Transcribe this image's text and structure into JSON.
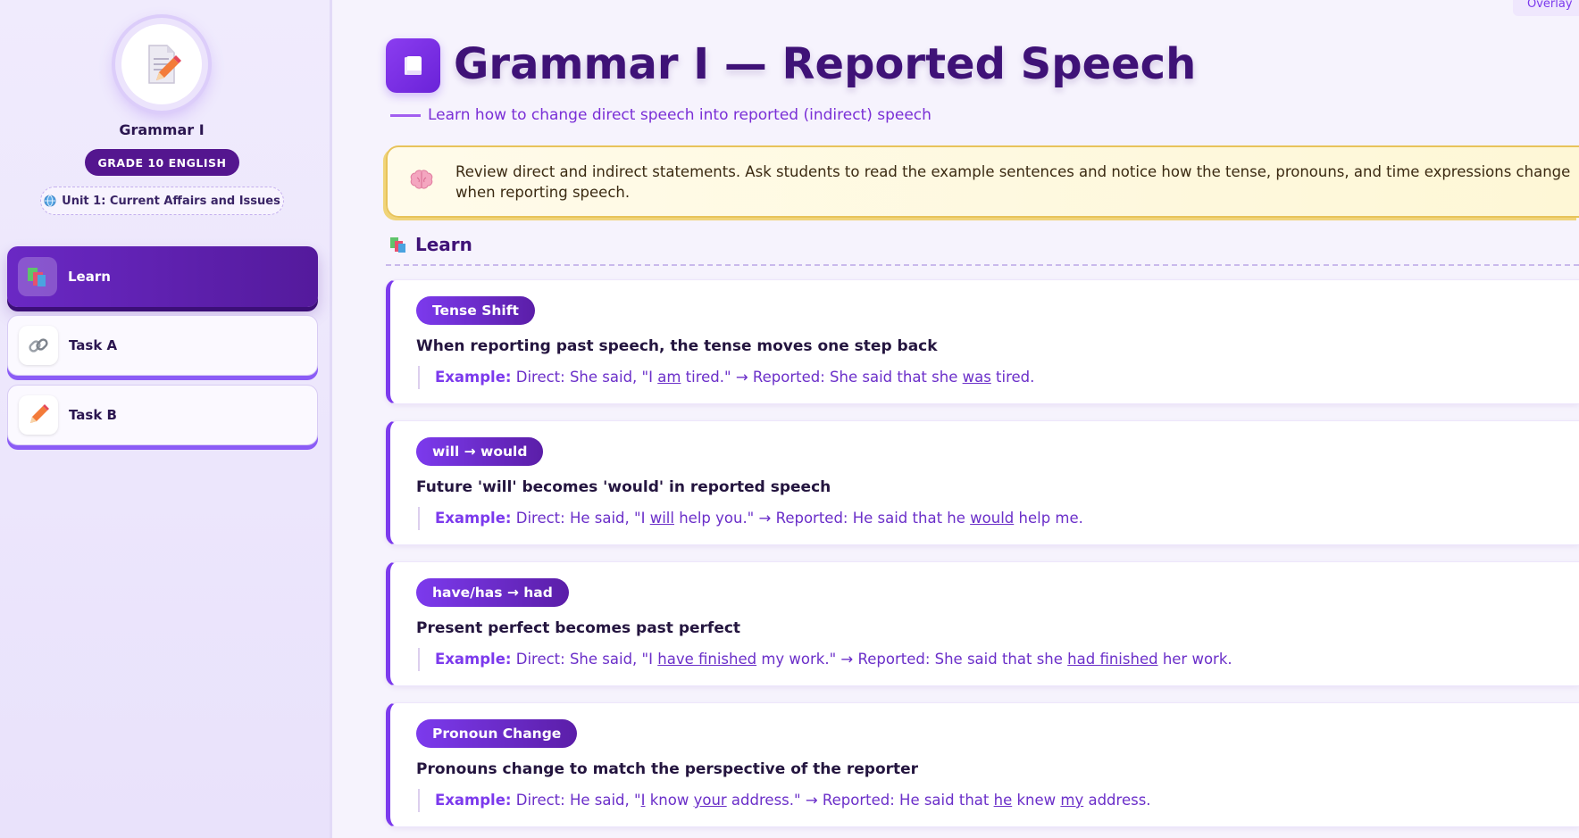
{
  "sidebar": {
    "title": "Grammar I",
    "grade_badge": "GRADE 10 ENGLISH",
    "unit": "Unit 1: Current Affairs and Issues",
    "items": [
      {
        "label": "Learn",
        "icon": "books-icon",
        "active": true
      },
      {
        "label": "Task A",
        "icon": "link-icon",
        "active": false
      },
      {
        "label": "Task B",
        "icon": "pencil-icon",
        "active": false
      }
    ]
  },
  "overlay_tab": "Overlay",
  "header": {
    "title": "Grammar I — Reported Speech",
    "subtitle": "Learn how to change direct speech into reported (indirect) speech"
  },
  "note": {
    "icon": "brain-icon",
    "text": "Review direct and indirect statements. Ask students to read the example sentences and notice how the tense, pronouns, and time expressions change when reporting speech."
  },
  "section": {
    "title": "Learn",
    "icon": "books-icon"
  },
  "example_label": "Example:",
  "cards": [
    {
      "badge": "Tense Shift",
      "rule": "When reporting past speech, the tense moves one step back",
      "example": {
        "p1": "Direct: She said, \"I ",
        "u1": "am",
        "p2": " tired.\" → Reported: She said that she ",
        "u2": "was",
        "p3": " tired."
      }
    },
    {
      "badge": "will → would",
      "rule": "Future 'will' becomes 'would' in reported speech",
      "example": {
        "p1": "Direct: He said, \"I ",
        "u1": "will",
        "p2": " help you.\" → Reported: He said that he ",
        "u2": "would",
        "p3": " help me."
      }
    },
    {
      "badge": "have/has → had",
      "rule": "Present perfect becomes past perfect",
      "example": {
        "p1": "Direct: She said, \"I ",
        "u1": "have finished",
        "p2": " my work.\" → Reported: She said that she ",
        "u2": "had finished",
        "p3": " her work."
      }
    },
    {
      "badge": "Pronoun Change",
      "rule": "Pronouns change to match the perspective of the reporter",
      "example": {
        "p1": "Direct: He said, \"",
        "u1": "I",
        "p2": " know ",
        "u2": "your",
        "p3": " address.\" → Reported: He said that ",
        "u3": "he",
        "p4": " knew ",
        "u4": "my",
        "p5": " address."
      }
    }
  ],
  "colors": {
    "accent": "#7c3aed",
    "dark_purple": "#54168f",
    "title": "#3f1277",
    "note_border": "#e8c35a"
  }
}
